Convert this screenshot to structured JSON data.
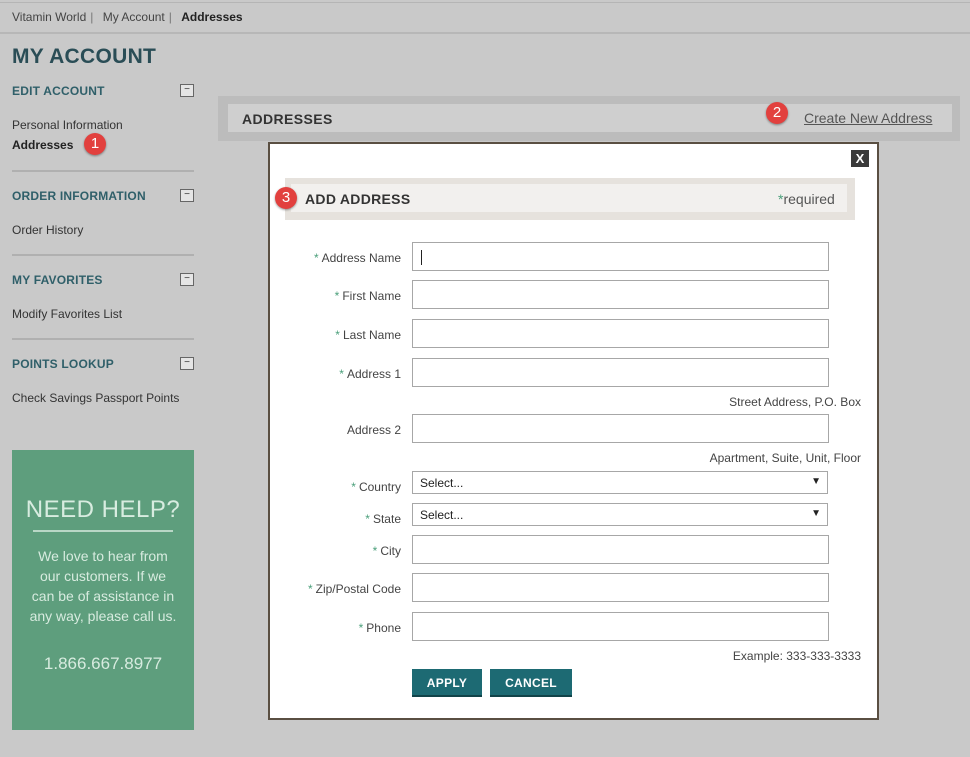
{
  "breadcrumb": {
    "items": [
      "Vitamin World",
      "My Account"
    ],
    "current": "Addresses"
  },
  "page_title": "MY ACCOUNT",
  "sidebar": {
    "sections": [
      {
        "title": "EDIT ACCOUNT",
        "links": [
          "Personal Information",
          "Addresses"
        ]
      },
      {
        "title": "ORDER INFORMATION",
        "links": [
          "Order History"
        ]
      },
      {
        "title": "MY FAVORITES",
        "links": [
          "Modify Favorites List"
        ]
      },
      {
        "title": "POINTS LOOKUP",
        "links": [
          "Check Savings Passport Points"
        ]
      }
    ],
    "collapse_symbol": "−"
  },
  "help": {
    "title": "NEED HELP?",
    "text": "We love to hear from our customers. If we can be of assistance in any way, please call us.",
    "phone": "1.866.667.8977"
  },
  "addresses_bar": {
    "title": "ADDRESSES",
    "create_link": "Create New Address"
  },
  "badges": {
    "one": "1",
    "two": "2",
    "three": "3"
  },
  "modal": {
    "close_label": "X",
    "title": "ADD ADDRESS",
    "required_star": "*",
    "required_text": "required",
    "fields": {
      "address_name": {
        "label": "Address Name",
        "star": "*"
      },
      "first_name": {
        "label": "First Name",
        "star": "*"
      },
      "last_name": {
        "label": "Last Name",
        "star": "*"
      },
      "address1": {
        "label": "Address 1",
        "star": "*",
        "hint": "Street Address, P.O. Box"
      },
      "address2": {
        "label": "Address 2",
        "hint": "Apartment, Suite, Unit, Floor"
      },
      "country": {
        "label": "Country",
        "star": "*",
        "value": "Select..."
      },
      "state": {
        "label": "State",
        "star": "*",
        "value": "Select..."
      },
      "city": {
        "label": "City",
        "star": "*"
      },
      "zip": {
        "label": "Zip/Postal Code",
        "star": "*"
      },
      "phone": {
        "label": "Phone",
        "star": "*",
        "hint": "Example: 333-333-3333"
      }
    },
    "apply_label": "APPLY",
    "cancel_label": "CANCEL"
  },
  "colors": {
    "accent": "#1d6a73",
    "help_bg": "#5e9e7d",
    "badge": "#e2403e",
    "required_star": "#4a9f7a"
  },
  "icons": {
    "dropdown": "▼"
  }
}
